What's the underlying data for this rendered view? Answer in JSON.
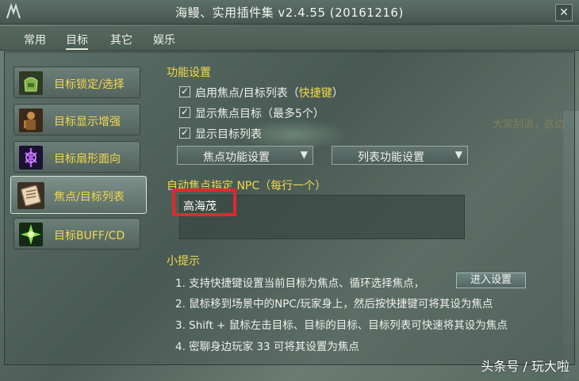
{
  "window": {
    "title": "海鳗、实用插件集 v2.4.55 (20161216)",
    "close_label": "✕"
  },
  "menu": {
    "items": [
      {
        "label": "常用",
        "active": false
      },
      {
        "label": "目标",
        "active": true
      },
      {
        "label": "其它",
        "active": false
      },
      {
        "label": "娱乐",
        "active": false
      }
    ]
  },
  "sidebar": {
    "items": [
      {
        "label": "目标锁定/选择",
        "icon": "bag-icon",
        "active": false
      },
      {
        "label": "目标显示增强",
        "icon": "warrior-icon",
        "active": false
      },
      {
        "label": "目标扇形面向",
        "icon": "purple-rune-icon",
        "active": false
      },
      {
        "label": "焦点/目标列表",
        "icon": "scroll-icon",
        "active": true
      },
      {
        "label": "目标BUFF/CD",
        "icon": "green-burst-icon",
        "active": false
      }
    ]
  },
  "settings": {
    "title": "功能设置",
    "checkboxes": [
      {
        "label": "启用焦点/目标列表（",
        "link": "快捷键",
        "suffix": "）",
        "checked": true
      },
      {
        "label": "显示焦点目标（最多5个）",
        "checked": true
      },
      {
        "label": "显示目标列表",
        "checked": true
      }
    ],
    "dropdowns": [
      {
        "label": "焦点功能设置"
      },
      {
        "label": "列表功能设置"
      }
    ],
    "npc": {
      "title": "自动焦点指定 NPC（每行一个）",
      "value": "高海茂"
    }
  },
  "tips": {
    "title": "小提示",
    "items": [
      "1. 支持快捷键设置当前目标为焦点、循环选择焦点，",
      "2. 鼠标移到场景中的NPC/玩家身上，然后按快捷键可将其设为焦点",
      "3. Shift + 鼠标左击目标、目标的目标、目标列表可快速将其设为焦点",
      "4. 密聊身边玩家 33 可将其设置为焦点"
    ],
    "enter_button": "进入设置"
  },
  "background": {
    "side_text": "大家刮流，这边"
  },
  "watermark": "头条号 / 玩大啦",
  "colors": {
    "accent_yellow": "#f3d84b",
    "highlight_red": "#e02a2a",
    "panel_green": "#52645d"
  }
}
